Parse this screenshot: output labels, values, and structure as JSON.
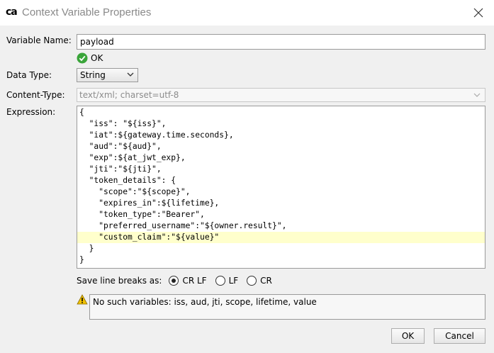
{
  "window": {
    "logo_text": "ca",
    "title": "Context Variable Properties"
  },
  "variable_name": {
    "label": "Variable Name:",
    "value": "payload",
    "status": "OK"
  },
  "data_type": {
    "label": "Data Type:",
    "selected": "String"
  },
  "content_type": {
    "label": "Content-Type:",
    "value": "text/xml; charset=utf-8"
  },
  "expression": {
    "label": "Expression:",
    "lines": [
      "{",
      "  \"iss\": \"${iss}\",",
      "  \"iat\":${gateway.time.seconds},",
      "  \"aud\":\"${aud}\",",
      "  \"exp\":${at_jwt_exp},",
      "  \"jti\":\"${jti}\",",
      "  \"token_details\": {",
      "    \"scope\":\"${scope}\",",
      "    \"expires_in\":${lifetime},",
      "    \"token_type\":\"Bearer\",",
      "    \"preferred_username\":\"${owner.result}\",",
      "    \"custom_claim\":\"${value}\"",
      "  }",
      "}"
    ],
    "highlighted_line": 11
  },
  "line_breaks": {
    "label": "Save line breaks as:",
    "options": [
      "CR LF",
      "LF",
      "CR"
    ],
    "selected": "CR LF"
  },
  "warning": {
    "message": "No such variables: iss, aud, jti, scope, lifetime, value"
  },
  "buttons": {
    "ok": "OK",
    "cancel": "Cancel"
  },
  "colors": {
    "highlight_line": "#ffffcc",
    "ok_check": "#3aa53a",
    "warning": "#f2c200"
  }
}
